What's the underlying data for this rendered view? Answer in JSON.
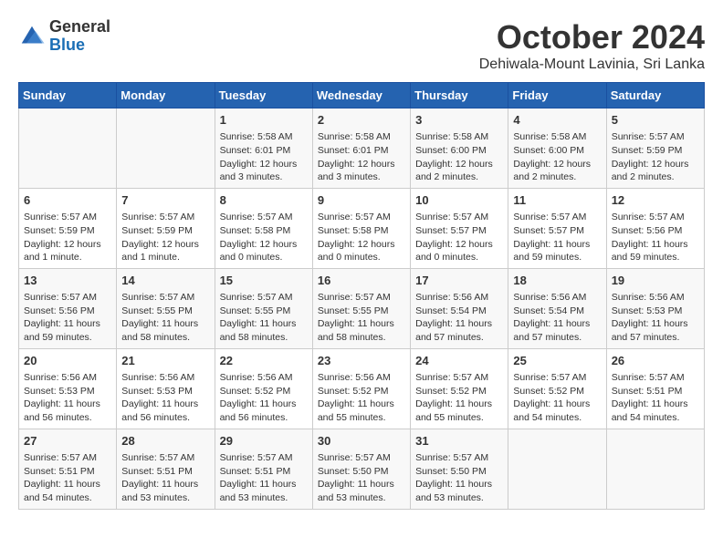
{
  "logo": {
    "general": "General",
    "blue": "Blue"
  },
  "title": {
    "month": "October 2024",
    "location": "Dehiwala-Mount Lavinia, Sri Lanka"
  },
  "headers": [
    "Sunday",
    "Monday",
    "Tuesday",
    "Wednesday",
    "Thursday",
    "Friday",
    "Saturday"
  ],
  "weeks": [
    [
      {
        "day": "",
        "info": ""
      },
      {
        "day": "",
        "info": ""
      },
      {
        "day": "1",
        "info": "Sunrise: 5:58 AM\nSunset: 6:01 PM\nDaylight: 12 hours and 3 minutes."
      },
      {
        "day": "2",
        "info": "Sunrise: 5:58 AM\nSunset: 6:01 PM\nDaylight: 12 hours and 3 minutes."
      },
      {
        "day": "3",
        "info": "Sunrise: 5:58 AM\nSunset: 6:00 PM\nDaylight: 12 hours and 2 minutes."
      },
      {
        "day": "4",
        "info": "Sunrise: 5:58 AM\nSunset: 6:00 PM\nDaylight: 12 hours and 2 minutes."
      },
      {
        "day": "5",
        "info": "Sunrise: 5:57 AM\nSunset: 5:59 PM\nDaylight: 12 hours and 2 minutes."
      }
    ],
    [
      {
        "day": "6",
        "info": "Sunrise: 5:57 AM\nSunset: 5:59 PM\nDaylight: 12 hours and 1 minute."
      },
      {
        "day": "7",
        "info": "Sunrise: 5:57 AM\nSunset: 5:59 PM\nDaylight: 12 hours and 1 minute."
      },
      {
        "day": "8",
        "info": "Sunrise: 5:57 AM\nSunset: 5:58 PM\nDaylight: 12 hours and 0 minutes."
      },
      {
        "day": "9",
        "info": "Sunrise: 5:57 AM\nSunset: 5:58 PM\nDaylight: 12 hours and 0 minutes."
      },
      {
        "day": "10",
        "info": "Sunrise: 5:57 AM\nSunset: 5:57 PM\nDaylight: 12 hours and 0 minutes."
      },
      {
        "day": "11",
        "info": "Sunrise: 5:57 AM\nSunset: 5:57 PM\nDaylight: 11 hours and 59 minutes."
      },
      {
        "day": "12",
        "info": "Sunrise: 5:57 AM\nSunset: 5:56 PM\nDaylight: 11 hours and 59 minutes."
      }
    ],
    [
      {
        "day": "13",
        "info": "Sunrise: 5:57 AM\nSunset: 5:56 PM\nDaylight: 11 hours and 59 minutes."
      },
      {
        "day": "14",
        "info": "Sunrise: 5:57 AM\nSunset: 5:55 PM\nDaylight: 11 hours and 58 minutes."
      },
      {
        "day": "15",
        "info": "Sunrise: 5:57 AM\nSunset: 5:55 PM\nDaylight: 11 hours and 58 minutes."
      },
      {
        "day": "16",
        "info": "Sunrise: 5:57 AM\nSunset: 5:55 PM\nDaylight: 11 hours and 58 minutes."
      },
      {
        "day": "17",
        "info": "Sunrise: 5:56 AM\nSunset: 5:54 PM\nDaylight: 11 hours and 57 minutes."
      },
      {
        "day": "18",
        "info": "Sunrise: 5:56 AM\nSunset: 5:54 PM\nDaylight: 11 hours and 57 minutes."
      },
      {
        "day": "19",
        "info": "Sunrise: 5:56 AM\nSunset: 5:53 PM\nDaylight: 11 hours and 57 minutes."
      }
    ],
    [
      {
        "day": "20",
        "info": "Sunrise: 5:56 AM\nSunset: 5:53 PM\nDaylight: 11 hours and 56 minutes."
      },
      {
        "day": "21",
        "info": "Sunrise: 5:56 AM\nSunset: 5:53 PM\nDaylight: 11 hours and 56 minutes."
      },
      {
        "day": "22",
        "info": "Sunrise: 5:56 AM\nSunset: 5:52 PM\nDaylight: 11 hours and 56 minutes."
      },
      {
        "day": "23",
        "info": "Sunrise: 5:56 AM\nSunset: 5:52 PM\nDaylight: 11 hours and 55 minutes."
      },
      {
        "day": "24",
        "info": "Sunrise: 5:57 AM\nSunset: 5:52 PM\nDaylight: 11 hours and 55 minutes."
      },
      {
        "day": "25",
        "info": "Sunrise: 5:57 AM\nSunset: 5:52 PM\nDaylight: 11 hours and 54 minutes."
      },
      {
        "day": "26",
        "info": "Sunrise: 5:57 AM\nSunset: 5:51 PM\nDaylight: 11 hours and 54 minutes."
      }
    ],
    [
      {
        "day": "27",
        "info": "Sunrise: 5:57 AM\nSunset: 5:51 PM\nDaylight: 11 hours and 54 minutes."
      },
      {
        "day": "28",
        "info": "Sunrise: 5:57 AM\nSunset: 5:51 PM\nDaylight: 11 hours and 53 minutes."
      },
      {
        "day": "29",
        "info": "Sunrise: 5:57 AM\nSunset: 5:51 PM\nDaylight: 11 hours and 53 minutes."
      },
      {
        "day": "30",
        "info": "Sunrise: 5:57 AM\nSunset: 5:50 PM\nDaylight: 11 hours and 53 minutes."
      },
      {
        "day": "31",
        "info": "Sunrise: 5:57 AM\nSunset: 5:50 PM\nDaylight: 11 hours and 53 minutes."
      },
      {
        "day": "",
        "info": ""
      },
      {
        "day": "",
        "info": ""
      }
    ]
  ]
}
